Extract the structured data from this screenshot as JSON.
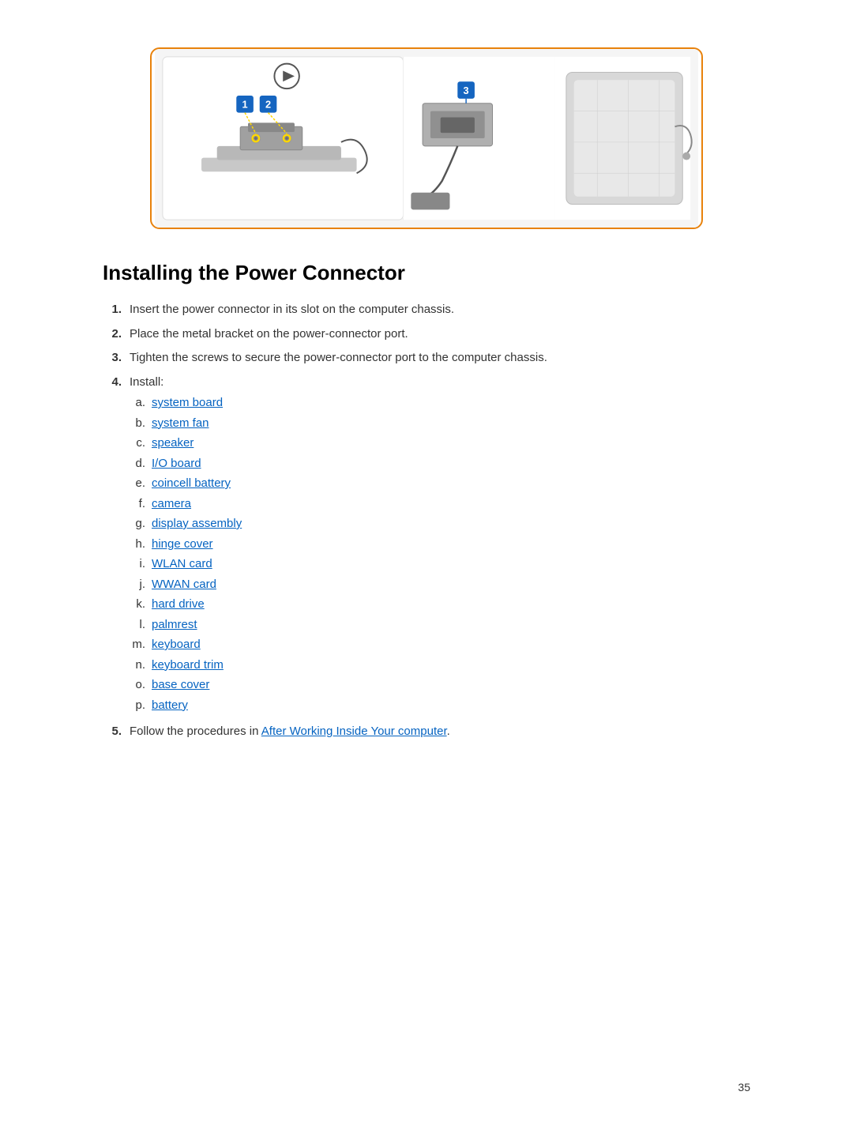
{
  "page": {
    "number": "35"
  },
  "diagram": {
    "alt": "Power connector installation diagram showing screws and connector port"
  },
  "section": {
    "title": "Installing the Power Connector"
  },
  "steps": [
    {
      "id": 1,
      "text": "Insert the power connector in its slot on the computer chassis.",
      "has_sub": false
    },
    {
      "id": 2,
      "text": "Place the metal bracket on the power-connector port.",
      "has_sub": false
    },
    {
      "id": 3,
      "text": "Tighten the screws to secure the power-connector port to the computer chassis.",
      "has_sub": false
    },
    {
      "id": 4,
      "text": "Install:",
      "has_sub": true,
      "sub_items": [
        {
          "label": "a.",
          "text": "system board",
          "link": true
        },
        {
          "label": "b.",
          "text": "system fan",
          "link": true
        },
        {
          "label": "c.",
          "text": "speaker",
          "link": true
        },
        {
          "label": "d.",
          "text": "I/O board",
          "link": true
        },
        {
          "label": "e.",
          "text": "coincell battery",
          "link": true
        },
        {
          "label": "f.",
          "text": "camera",
          "link": true
        },
        {
          "label": "g.",
          "text": "display assembly",
          "link": true
        },
        {
          "label": "h.",
          "text": "hinge cover",
          "link": true
        },
        {
          "label": "i.",
          "text": "WLAN card",
          "link": true
        },
        {
          "label": "j.",
          "text": "WWAN card",
          "link": true
        },
        {
          "label": "k.",
          "text": "hard drive",
          "link": true
        },
        {
          "label": "l.",
          "text": "palmrest",
          "link": true
        },
        {
          "label": "m.",
          "text": "keyboard",
          "link": true
        },
        {
          "label": "n.",
          "text": "keyboard trim",
          "link": true
        },
        {
          "label": "o.",
          "text": "base cover",
          "link": true
        },
        {
          "label": "p.",
          "text": "battery",
          "link": true
        }
      ]
    },
    {
      "id": 5,
      "text": "Follow the procedures in",
      "link_text": "After Working Inside Your computer",
      "link": true,
      "text_after": ".",
      "has_sub": false
    }
  ]
}
